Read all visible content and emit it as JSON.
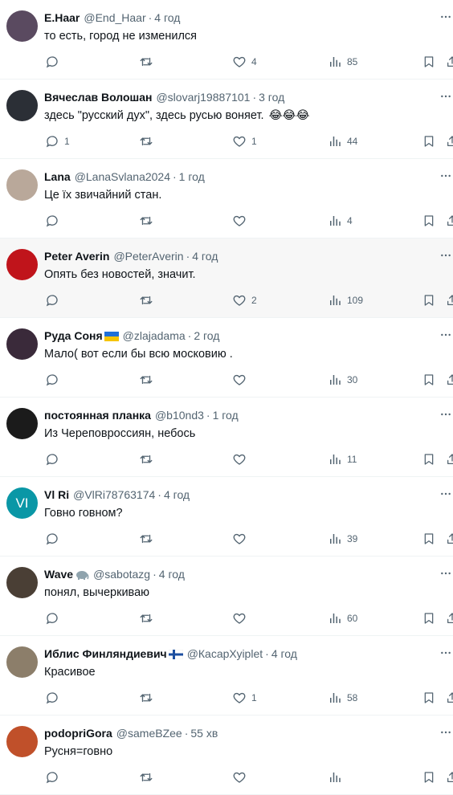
{
  "tweets": [
    {
      "name": "E.Haar",
      "handle": "@End_Haar",
      "time": "4 год",
      "text": "то есть, город не изменился",
      "replies": "",
      "likes": "4",
      "views": "85",
      "avatar_color": "#5a4a60",
      "highlight": false
    },
    {
      "name": "Вячеслав Волошан",
      "handle": "@slovarj19887101",
      "time": "3 год",
      "text": "здесь \"русский дух\", здесь русью воняет.",
      "emojis": "😂😂😂",
      "replies": "1",
      "likes": "1",
      "views": "44",
      "avatar_color": "#2b2f36",
      "highlight": false
    },
    {
      "name": "Lana",
      "handle": "@LanaSvlana2024",
      "time": "1 год",
      "text": "Це їх звичайний стан.",
      "replies": "",
      "likes": "",
      "views": "4",
      "avatar_color": "#b9a89a",
      "highlight": false
    },
    {
      "name": "Peter Averin",
      "handle": "@PeterAverin",
      "time": "4 год",
      "text": "Опять без новостей, значит.",
      "replies": "",
      "likes": "2",
      "views": "109",
      "avatar_color": "#c0141b",
      "highlight": true
    },
    {
      "name": "Руда Соня",
      "handle": "@zlajadama",
      "time": "2 год",
      "text": "Мало( вот если бы всю московию .",
      "replies": "",
      "likes": "",
      "views": "30",
      "avatar_color": "#3a2a3a",
      "highlight": false,
      "flag": "ua"
    },
    {
      "name": "постоянная планка",
      "handle": "@b10nd3",
      "time": "1 год",
      "text": "Из Череповроссиян, небось",
      "replies": "",
      "likes": "",
      "views": "11",
      "avatar_color": "#1b1b1b",
      "highlight": false
    },
    {
      "name": "Vl Ri",
      "handle": "@VlRi78763174",
      "time": "4 год",
      "text": "Говно говном?",
      "replies": "",
      "likes": "",
      "views": "39",
      "avatar_color": "#0a97a6",
      "avatar_initials": "VI",
      "highlight": false
    },
    {
      "name": "Wave",
      "handle": "@sabotazg",
      "time": "4 год",
      "text": "понял, вычеркиваю",
      "replies": "",
      "likes": "",
      "views": "60",
      "avatar_color": "#4a3f35",
      "highlight": false,
      "flag": "elephant"
    },
    {
      "name": "Иблис Финляндиевич",
      "handle": "@КасарХуiplet",
      "time": "4 год",
      "text": "Красивое",
      "replies": "",
      "likes": "1",
      "views": "58",
      "avatar_color": "#8c7e6a",
      "highlight": false,
      "flag": "fi"
    },
    {
      "name": "podopriGora",
      "handle": "@sameBZee",
      "time": "55 хв",
      "text": "Русня=говно",
      "replies": "",
      "likes": "",
      "views": "",
      "avatar_color": "#c0502a",
      "highlight": false
    }
  ],
  "icons": {
    "more": "more-horizontal-icon",
    "reply": "reply-icon",
    "retweet": "retweet-icon",
    "like": "heart-icon",
    "views": "views-icon",
    "bookmark": "bookmark-icon",
    "share": "share-icon"
  },
  "colors": {
    "muted": "#536471",
    "text": "#0f1419",
    "divider": "#eff3f4"
  }
}
